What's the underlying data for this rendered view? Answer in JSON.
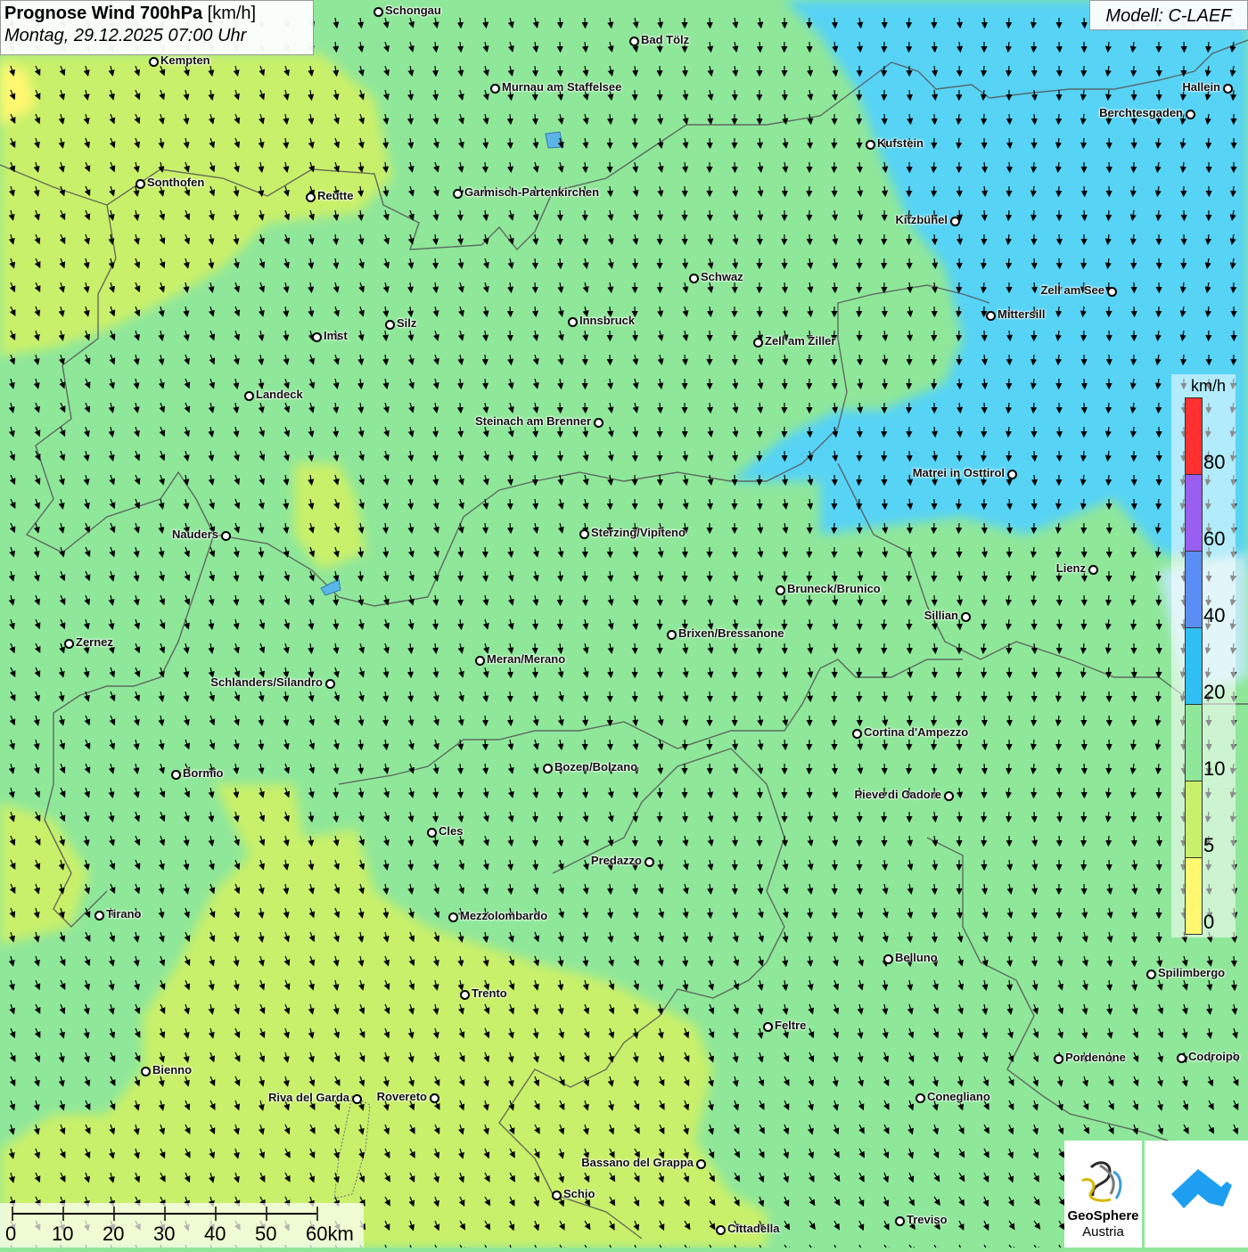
{
  "header": {
    "title_bold": "Prognose Wind 700hPa",
    "title_unit": "[km/h]",
    "datetime": "Montag, 29.12.2025 07:00 Uhr",
    "model": "Modell: C-LAEF"
  },
  "legend": {
    "unit": "km/h",
    "labels": [
      "80",
      "60",
      "40",
      "20",
      "10",
      "5",
      "0"
    ],
    "colors": [
      "#ff3030",
      "#9a5ef0",
      "#5a8ef5",
      "#2fbff2",
      "#8fe79a",
      "#c9f06a",
      "#fff870"
    ]
  },
  "scale": {
    "labels": [
      "0",
      "10",
      "20",
      "30",
      "40",
      "50",
      "60km"
    ]
  },
  "logo": {
    "line1": "GeoSphere",
    "line2": "Austria"
  },
  "cities": [
    {
      "name": "Schongau"
    },
    {
      "name": "Bad Tölz"
    },
    {
      "name": "Kempten"
    },
    {
      "name": "Murnau am Staffelsee"
    },
    {
      "name": "Hallein"
    },
    {
      "name": "Berchtesgaden"
    },
    {
      "name": "Kufstein"
    },
    {
      "name": "Sonthofen"
    },
    {
      "name": "Reutte"
    },
    {
      "name": "Garmisch-Partenkirchen"
    },
    {
      "name": "Kitzbühel"
    },
    {
      "name": "Schwaz"
    },
    {
      "name": "Zell am See"
    },
    {
      "name": "Mittersill"
    },
    {
      "name": "Innsbruck"
    },
    {
      "name": "Silz"
    },
    {
      "name": "Imst"
    },
    {
      "name": "Zell am Ziller"
    },
    {
      "name": "Landeck"
    },
    {
      "name": "Steinach am Brenner"
    },
    {
      "name": "Matrei in Osttirol"
    },
    {
      "name": "Nauders"
    },
    {
      "name": "Sterzing/Vipiteno"
    },
    {
      "name": "Lienz"
    },
    {
      "name": "Bruneck/Brunico"
    },
    {
      "name": "Sillian"
    },
    {
      "name": "Zernez"
    },
    {
      "name": "Brixen/Bressanone"
    },
    {
      "name": "Meran/Merano"
    },
    {
      "name": "Schlanders/Silandro"
    },
    {
      "name": "Cortina d'Ampezzo"
    },
    {
      "name": "Bormio"
    },
    {
      "name": "Bozen/Bolzano"
    },
    {
      "name": "Pieve di Cadore"
    },
    {
      "name": "Cles"
    },
    {
      "name": "Predazzo"
    },
    {
      "name": "Tirano"
    },
    {
      "name": "Mezzolombardo"
    },
    {
      "name": "Belluno"
    },
    {
      "name": "Spilimbergo"
    },
    {
      "name": "Trento"
    },
    {
      "name": "Feltre"
    },
    {
      "name": "Pordenone"
    },
    {
      "name": "Codroipo"
    },
    {
      "name": "Bienno"
    },
    {
      "name": "Riva del Garda"
    },
    {
      "name": "Rovereto"
    },
    {
      "name": "Conegliano"
    },
    {
      "name": "Bassano del Grappa"
    },
    {
      "name": "Schio"
    },
    {
      "name": "Treviso"
    },
    {
      "name": "Cittadella"
    }
  ]
}
